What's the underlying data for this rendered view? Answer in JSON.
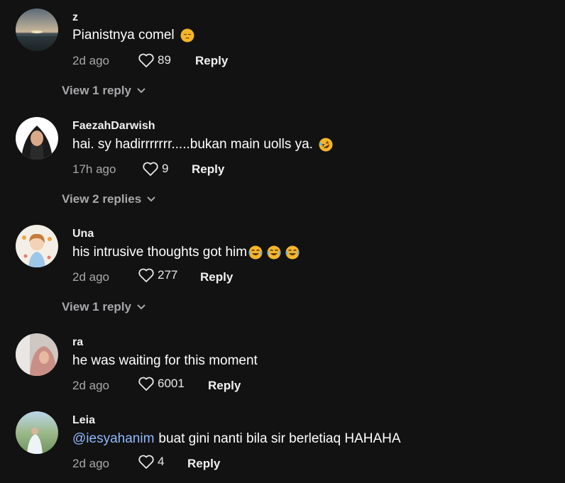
{
  "comments": [
    {
      "username": "z",
      "text": "Pianistnya comel",
      "emojis": [
        "pensive-face"
      ],
      "time": "2d ago",
      "likes": "89",
      "reply_label": "Reply",
      "view_replies": "View 1 reply"
    },
    {
      "username": "FaezahDarwish",
      "text": "hai. sy hadirrrrrrr.....bukan main uolls ya.",
      "emojis": [
        "rolling-laughing-face"
      ],
      "time": "17h ago",
      "likes": "9",
      "reply_label": "Reply",
      "view_replies": "View 2 replies"
    },
    {
      "username": "Una",
      "text": "his intrusive thoughts got him",
      "emojis": [
        "joy-face",
        "joy-face",
        "joy-face"
      ],
      "time": "2d ago",
      "likes": "277",
      "reply_label": "Reply",
      "view_replies": "View 1 reply"
    },
    {
      "username": "ra",
      "text": "he was waiting for this moment",
      "emojis": [],
      "time": "2d ago",
      "likes": "6001",
      "reply_label": "Reply"
    },
    {
      "username": "Leia",
      "mention": "@iesyahanim",
      "text": "buat gini nanti bila sir berletiaq HAHAHA",
      "emojis": [],
      "time": "2d ago",
      "likes": "4",
      "reply_label": "Reply"
    }
  ],
  "colors": {
    "background": "#121212",
    "secondary_text": "#a8a8ab",
    "mention": "#8fb8ff",
    "emoji": "#f5b52a"
  },
  "icons": {
    "like": "heart-outline-icon",
    "expand": "chevron-down-icon"
  }
}
